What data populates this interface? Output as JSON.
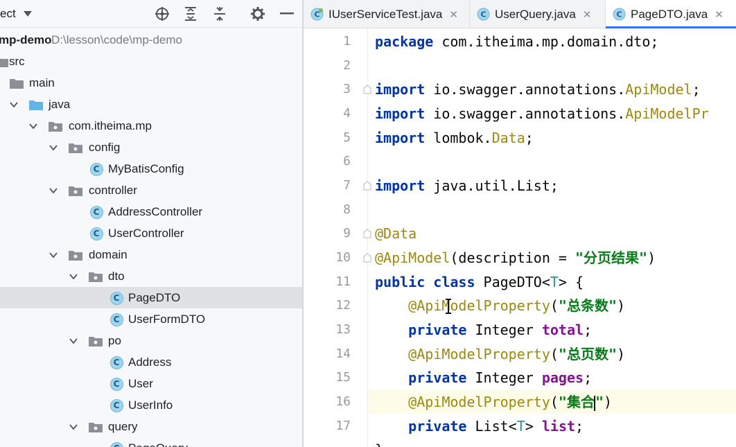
{
  "project_panel": {
    "title": "ect",
    "tree": [
      {
        "label": "mp-demo",
        "path": "D:\\lesson\\code\\mp-demo",
        "kind": "module"
      },
      {
        "label": "src",
        "kind": "folder"
      },
      {
        "label": "main",
        "kind": "folder"
      },
      {
        "label": "java",
        "kind": "source-folder",
        "expanded": true
      },
      {
        "label": "com.itheima.mp",
        "kind": "package",
        "expanded": true
      },
      {
        "label": "config",
        "kind": "package",
        "expanded": true
      },
      {
        "label": "MyBatisConfig",
        "kind": "class"
      },
      {
        "label": "controller",
        "kind": "package",
        "expanded": true
      },
      {
        "label": "AddressController",
        "kind": "class"
      },
      {
        "label": "UserController",
        "kind": "class"
      },
      {
        "label": "domain",
        "kind": "package",
        "expanded": true
      },
      {
        "label": "dto",
        "kind": "package",
        "expanded": true
      },
      {
        "label": "PageDTO",
        "kind": "class",
        "selected": true
      },
      {
        "label": "UserFormDTO",
        "kind": "class"
      },
      {
        "label": "po",
        "kind": "package",
        "expanded": true
      },
      {
        "label": "Address",
        "kind": "class"
      },
      {
        "label": "User",
        "kind": "class"
      },
      {
        "label": "UserInfo",
        "kind": "class"
      },
      {
        "label": "query",
        "kind": "package",
        "expanded": true
      },
      {
        "label": "PageQuery",
        "kind": "class"
      }
    ]
  },
  "editor": {
    "tabs": [
      {
        "label": "IUserServiceTest.java",
        "active": false,
        "close": "✕"
      },
      {
        "label": "UserQuery.java",
        "active": false,
        "close": "✕"
      },
      {
        "label": "PageDTO.java",
        "active": true,
        "close": "✕"
      }
    ],
    "line_numbers": [
      "1",
      "2",
      "3",
      "4",
      "5",
      "6",
      "7",
      "8",
      "9",
      "10",
      "11",
      "12",
      "13",
      "14",
      "15",
      "16",
      "17"
    ],
    "current_line": 16,
    "code": {
      "l1": {
        "kw": "package",
        "rest": " com.itheima.mp.domain.dto;"
      },
      "l3": {
        "kw": "import",
        "pkg": " io.swagger.annotations.",
        "cls": "ApiModel",
        "end": ";"
      },
      "l4": {
        "kw": "import",
        "pkg": " io.swagger.annotations.",
        "cls": "ApiModelPr"
      },
      "l5": {
        "kw": "import",
        "pkg": " lombok.",
        "cls": "Data",
        "end": ";"
      },
      "l7": {
        "kw": "import",
        "rest": " java.util.List;"
      },
      "l9": {
        "ann": "@Data"
      },
      "l10": {
        "ann": "@ApiModel",
        "open": "(description = ",
        "str": "\"分页结果\"",
        "close": ")"
      },
      "l11": {
        "kw1": "public",
        "kw2": " class",
        "name": " PageDTO<",
        "tp": "T",
        "end": "> {"
      },
      "l12": {
        "ann": "@ApiModelProperty",
        "open": "(",
        "str": "\"总条数\"",
        "close": ")"
      },
      "l13": {
        "kw": "private",
        "type": " Integer ",
        "fld": "total",
        "end": ";"
      },
      "l14": {
        "ann": "@ApiModelProperty",
        "open": "(",
        "str": "\"总页数\"",
        "close": ")"
      },
      "l15": {
        "kw": "private",
        "type": " Integer ",
        "fld": "pages",
        "end": ";"
      },
      "l16": {
        "ann": "@ApiModelProperty",
        "open": "(",
        "str_a": "\"集合",
        "str_b": "\"",
        "close": ")"
      },
      "l17": {
        "kw": "private",
        "type": " List<",
        "tp": "T",
        "type2": "> ",
        "fld": "list",
        "end": ";"
      },
      "l18": {
        "end": "}"
      }
    }
  },
  "colors": {
    "keyword": "#0033b3",
    "annotation": "#9e880d",
    "string": "#067d17",
    "field": "#871094",
    "type_param": "#20999d",
    "selection": "#dfe1e5",
    "current_line": "#fdfce8",
    "tab_accent": "#3574f0",
    "class_icon": "#9fd5f0"
  },
  "icons": [
    "caret-down-icon",
    "crosshair-icon",
    "expand-all-icon",
    "collapse-all-icon",
    "gear-icon",
    "minimize-icon",
    "chevron-down-icon",
    "folder-icon",
    "package-icon",
    "class-icon",
    "close-icon",
    "lightbulb-icon",
    "fold-marker-icon",
    "text-cursor-icon"
  ]
}
